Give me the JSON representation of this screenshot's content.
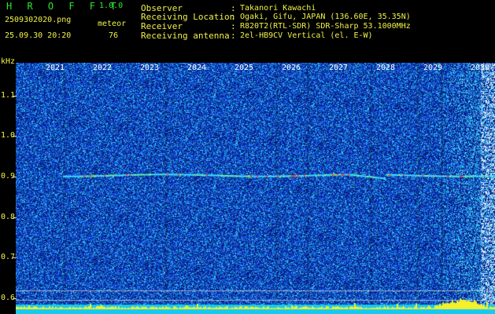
{
  "header": {
    "app_title": "H R O F F T",
    "app_version": "1.0.0",
    "file_name": "2509302020.png",
    "meteor_label": "meteor",
    "date_time": "25.09.30 20:20",
    "meteor_count": "76",
    "info": [
      {
        "key": "Observer",
        "sep": ":",
        "value": "Takanori Kawachi"
      },
      {
        "key": "Receiving Location",
        "sep": ":",
        "value": "Ogaki, Gifu, JAPAN (136.60E, 35.35N)"
      },
      {
        "key": "Receiver",
        "sep": ":",
        "value": "R820T2(RTL-SDR) SDR-Sharp 53.1000MHz"
      },
      {
        "key": "Receiving antenna",
        "sep": ":",
        "value": "2el-HB9CV Vertical (el. E-W)"
      }
    ]
  },
  "colors": {
    "text": "#f2f24a",
    "title": "#2ee62e",
    "background_blue": "#0a1f7a",
    "cyan_bottom": "#17c9ef"
  },
  "chart_data": {
    "type": "heatmap",
    "ylabel": "kHz",
    "y_ticks": [
      "1.1",
      "1.0",
      "0.9",
      "0.8",
      "0.7",
      "0.6"
    ],
    "x_ticks": [
      "2021",
      "2022",
      "2023",
      "2024",
      "2025",
      "2026",
      "2027",
      "2028",
      "2029",
      "2030"
    ],
    "ylim": [
      0.6,
      1.15
    ],
    "carrier_line_khz": 0.905
  }
}
